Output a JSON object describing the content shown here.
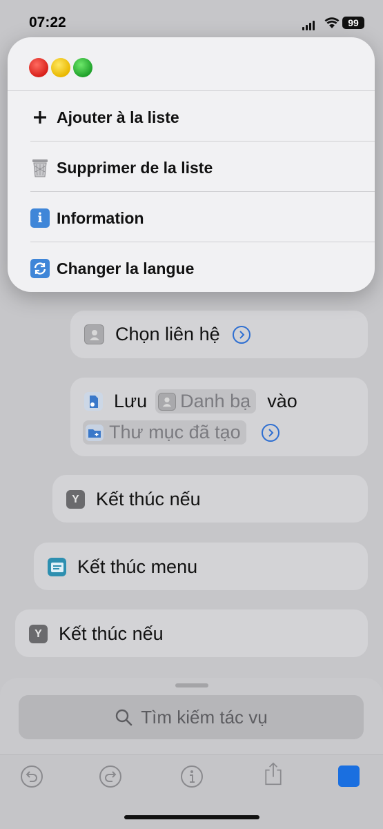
{
  "status": {
    "time": "07:22",
    "battery": "99"
  },
  "menu": {
    "items": [
      {
        "label": "Ajouter à la liste",
        "icon": "plus-icon"
      },
      {
        "label": "Supprimer de la liste",
        "icon": "wastebasket-icon"
      },
      {
        "label": "Information",
        "icon": "information-icon"
      },
      {
        "label": "Changer la langue",
        "icon": "sync-arrows-icon"
      }
    ]
  },
  "actions": {
    "choose_contact": {
      "label": "Chọn liên hệ"
    },
    "save": {
      "verb": "Lưu",
      "token1": "Danh bạ",
      "connector": "vào",
      "token2": "Thư mục đã tạo"
    },
    "end_if_inner": {
      "label": "Kết thúc nếu"
    },
    "end_menu": {
      "label": "Kết thúc menu"
    },
    "end_if_outer": {
      "label": "Kết thúc nếu"
    }
  },
  "search": {
    "placeholder": "Tìm kiếm tác vụ"
  },
  "colors": {
    "accent": "#1a6fe0",
    "menu_bg": "#f1f1f3",
    "background": "#c6c6c9"
  }
}
